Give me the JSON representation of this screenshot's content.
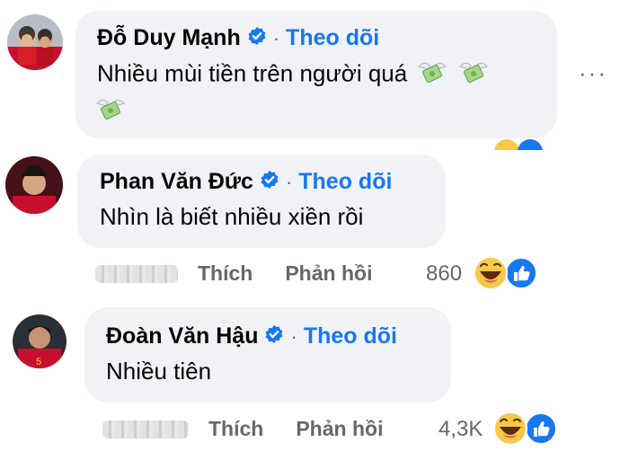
{
  "comments": [
    {
      "author": "Đỗ Duy Mạnh",
      "follow_label": "Theo dõi",
      "separator": "·",
      "text_line1": "Nhiều mùi tiền trên người quá",
      "emoji": "money-with-wings"
    },
    {
      "author": "Phan Văn Đức",
      "follow_label": "Theo dõi",
      "separator": "·",
      "text_line1": "Nhìn là biết nhiều xiền rồi",
      "like_label": "Thích",
      "reply_label": "Phản hồi",
      "reaction_count": "860"
    },
    {
      "author": "Đoàn Văn Hậu",
      "follow_label": "Theo dõi",
      "separator": "·",
      "text_line1": "Nhiều tiên",
      "like_label": "Thích",
      "reply_label": "Phản hồi",
      "reaction_count": "4,3K"
    }
  ],
  "more_options": "···",
  "colors": {
    "bubble": "#f0f2f5",
    "follow": "#1877f2",
    "secondary_text": "#65676b",
    "verified": "#1877f2"
  }
}
